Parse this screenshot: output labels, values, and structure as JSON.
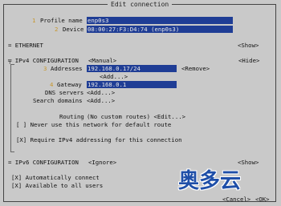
{
  "dialog": {
    "title": "Edit connection"
  },
  "profile": {
    "num": "1",
    "label": "Profile name",
    "value": "enp0s3"
  },
  "device": {
    "num": "2",
    "label": "Device",
    "value": "08:00:27:F3:D4:74 (enp0s3)"
  },
  "ethernet": {
    "label": "= ETHERNET",
    "toggle": "<Show>"
  },
  "ipv4": {
    "label": "╤ IPv4 CONFIGURATION",
    "mode": "<Manual>",
    "toggle": "<Hide>",
    "addresses_num": "3",
    "addresses_label": "Addresses",
    "address_value": "192.168.0.17/24",
    "remove": "<Remove>",
    "add_address": "<Add...>",
    "gateway_num": "4",
    "gateway_label": "Gateway",
    "gateway_value": "192.168.0.1",
    "dns_label": "DNS servers",
    "dns_add": "<Add...>",
    "search_label": "Search domains",
    "search_add": "<Add...>",
    "routing_label": "Routing",
    "routing_value": "(No custom routes) <Edit...>",
    "never_default": "[ ] Never use this network for default route",
    "require_ipv4": "[X] Require IPv4 addressing for this connection"
  },
  "ipv6": {
    "label": "= IPv6 CONFIGURATION",
    "mode": "<Ignore>",
    "toggle": "<Show>"
  },
  "options": {
    "auto_connect": "[X] Automatically connect",
    "all_users": "[X] Available to all users"
  },
  "buttons": {
    "cancel": "<Cancel>",
    "ok": "<OK>"
  },
  "watermark": {
    "text": "奥多云",
    "color": "#1f4fa8"
  }
}
